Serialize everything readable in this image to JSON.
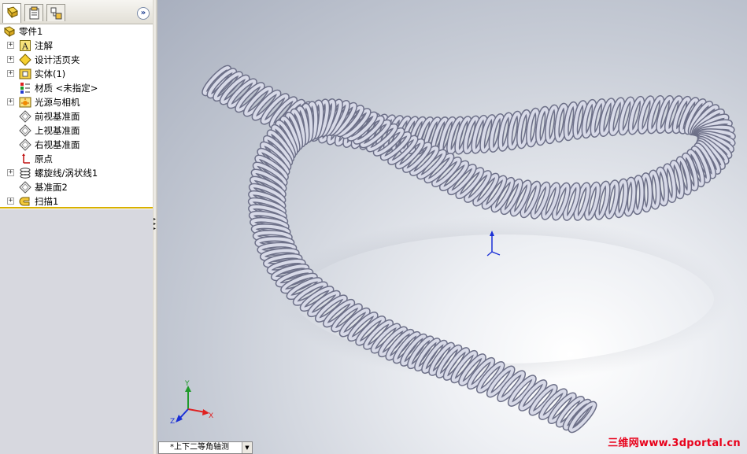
{
  "tree": {
    "root_label": "零件1",
    "items": [
      {
        "label": "注解",
        "icon": "annotations-icon",
        "expandable": true
      },
      {
        "label": "设计活页夹",
        "icon": "design-binder-icon",
        "expandable": true
      },
      {
        "label": "实体(1)",
        "icon": "solid-bodies-icon",
        "expandable": true
      },
      {
        "label": "材质 <未指定>",
        "icon": "material-icon",
        "expandable": false
      },
      {
        "label": "光源与相机",
        "icon": "lights-cameras-icon",
        "expandable": true
      },
      {
        "label": "前视基准面",
        "icon": "plane-icon",
        "expandable": false
      },
      {
        "label": "上视基准面",
        "icon": "plane-icon",
        "expandable": false
      },
      {
        "label": "右视基准面",
        "icon": "plane-icon",
        "expandable": false
      },
      {
        "label": "原点",
        "icon": "origin-icon",
        "expandable": false
      },
      {
        "label": "螺旋线/涡状线1",
        "icon": "helix-icon",
        "expandable": true
      },
      {
        "label": "基准面2",
        "icon": "plane-icon",
        "expandable": false
      },
      {
        "label": "扫描1",
        "icon": "sweep-icon",
        "expandable": true
      }
    ]
  },
  "tabs": [
    {
      "name": "featuremanager",
      "icon": "feature-manager-icon"
    },
    {
      "name": "propertymanager",
      "icon": "property-manager-icon"
    },
    {
      "name": "configurationmanager",
      "icon": "configuration-manager-icon"
    }
  ],
  "collapse_glyph": "»",
  "viewport": {
    "view_label": "*上下二等角轴测",
    "dropdown_glyph": "▼",
    "triad": {
      "x": "X",
      "y": "Y",
      "z": "Z"
    },
    "watermark": "三维网www.3dportal.cn",
    "colors": {
      "spring": "#d8dae8",
      "spring_dark": "#6d7088",
      "triad_x": "#e02020",
      "triad_y": "#1f9a2a",
      "triad_z": "#1a2fd6"
    }
  }
}
